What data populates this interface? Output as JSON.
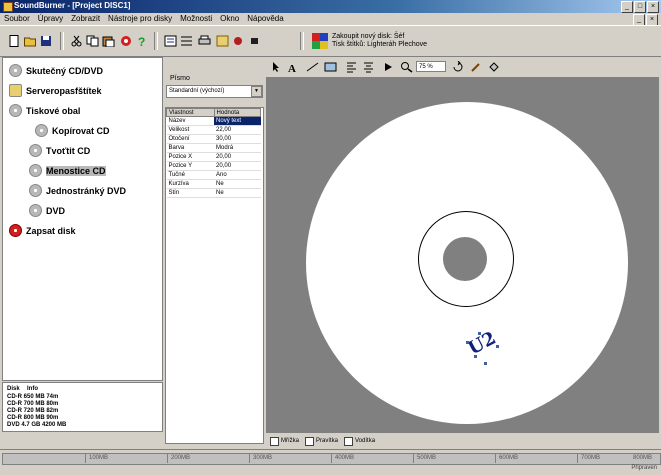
{
  "window": {
    "title": "SoundBurner - [Project DISC1]",
    "controls": [
      "_",
      "□",
      "×"
    ]
  },
  "menu": [
    "Soubor",
    "Úpravy",
    "Zobrazit",
    "Nástroje pro disky",
    "Možnosti",
    "Okno",
    "Nápověda"
  ],
  "toolbar": {
    "hint_line1": "Zakoupit nový disk: Šéf",
    "hint_line2": "Tisk štítků: Lighteráh Plechove"
  },
  "tree": {
    "items": [
      {
        "label": "Skutečný CD/DVD"
      },
      {
        "label": "Serveropasfštítek"
      },
      {
        "label": "Tiskové obal"
      },
      {
        "label": "Kopírovat CD"
      },
      {
        "label": "Tvoťtit CD"
      },
      {
        "label": "Menostice CD"
      },
      {
        "label": "Jednostránký DVD"
      },
      {
        "label": "DVD"
      },
      {
        "label": "Zapsat disk"
      }
    ]
  },
  "capacity": {
    "header": [
      "Disk",
      "Info"
    ],
    "rows": [
      "CD-R 650 MB 74m",
      "CD-R 700 MB 80m",
      "CD-R 720 MB 82m",
      "CD-R 800 MB 90m",
      "DVD 4.7 GB 4200 MB"
    ]
  },
  "properties": {
    "font_label": "Písmo",
    "font_value": "Standardní (výchozí)",
    "columns": [
      "Vlastnost",
      "Hodnota"
    ],
    "rows": [
      {
        "name": "Název",
        "value": "Nový text"
      },
      {
        "name": "Velikost",
        "value": "22,00"
      },
      {
        "name": "Otočení",
        "value": "30,00"
      },
      {
        "name": "Barva",
        "value": "Modrá"
      },
      {
        "name": "Pozice X",
        "value": "20,00"
      },
      {
        "name": "Pozice Y",
        "value": "20,00"
      },
      {
        "name": "Tučné",
        "value": "Ano"
      },
      {
        "name": "Kurzíva",
        "value": "Ne"
      },
      {
        "name": "Stín",
        "value": "Ne"
      }
    ]
  },
  "zoom": "75 %",
  "canvas": {
    "label_text": "U2"
  },
  "bottom_checks": [
    "Mřížka",
    "Pravítka",
    "Vodítka"
  ],
  "ruler": [
    "100MB",
    "200MB",
    "300MB",
    "400MB",
    "500MB",
    "600MB",
    "700MB",
    "800MB"
  ],
  "status": "Připraven",
  "colors": {
    "titlebar": "#0a246a",
    "canvas_bg": "#808080",
    "disc": "#ffffff",
    "label_text": "#102078"
  }
}
